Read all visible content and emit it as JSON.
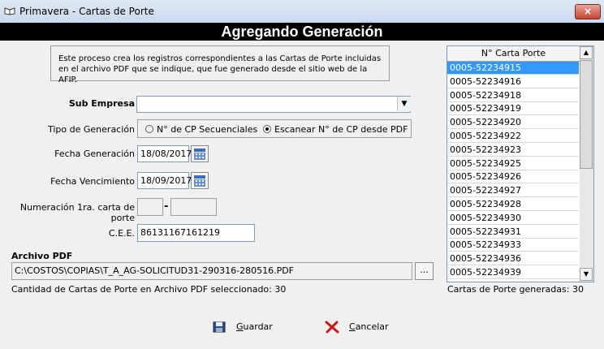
{
  "window": {
    "title": "Primavera - Cartas de Porte",
    "close_label": "×"
  },
  "banner": {
    "title": "Agregando Generación"
  },
  "info": {
    "line1": "Este proceso crea los registros correspondientes a las Cartas de Porte incluidas",
    "line2": "en el archivo PDF que se indique, que fue generado desde el sitio web de la AFIP."
  },
  "form": {
    "sub_empresa_label": "Sub Empresa",
    "sub_empresa_value": "",
    "tipo_label": "Tipo de Generación",
    "tipo_options": [
      {
        "label": "N° de CP Secuenciales",
        "selected": false
      },
      {
        "label": "Escanear N° de CP desde PDF",
        "selected": true
      }
    ],
    "fecha_gen_label": "Fecha Generación",
    "fecha_gen_value": "18/08/2017",
    "fecha_venc_label": "Fecha Vencimiento",
    "fecha_venc_value": "18/09/2017",
    "numeracion_label": "Numeración 1ra. carta de porte",
    "numeracion_sep": "-",
    "cee_label": "C.E.E.",
    "cee_value": "86131167161219",
    "archivo_label": "Archivo PDF",
    "archivo_value": "C:\\COSTOS\\COPIAS\\T_A_AG-SOLICITUD31-290316-280516.PDF",
    "browse_label": "...",
    "cantidad_text": "Cantidad de Cartas de Porte en Archivo PDF seleccionado: 30"
  },
  "list": {
    "header": "N° Carta Porte",
    "rows": [
      "0005-52234915",
      "0005-52234916",
      "0005-52234918",
      "0005-52234919",
      "0005-52234920",
      "0005-52234922",
      "0005-52234923",
      "0005-52234925",
      "0005-52234926",
      "0005-52234927",
      "0005-52234928",
      "0005-52234930",
      "0005-52234931",
      "0005-52234933",
      "0005-52234936",
      "0005-52234939"
    ],
    "selected_index": 0,
    "generated_text": "Cartas de Porte generadas: 30"
  },
  "buttons": {
    "guardar_first": "G",
    "guardar_rest": "uardar",
    "cancelar_first": "C",
    "cancelar_rest": "ancelar"
  }
}
